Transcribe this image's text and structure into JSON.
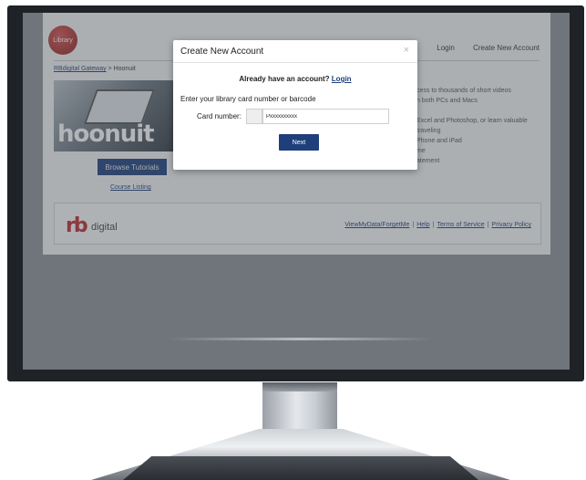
{
  "logo": {
    "text": "Library"
  },
  "top_nav": {
    "login": "Login",
    "create_account": "Create New Account"
  },
  "breadcrumb": {
    "gateway": "RBdigital Gateway",
    "separator": " > ",
    "current": "Hoonuit"
  },
  "hero": {
    "brand": "hoonuit"
  },
  "browse_button": "Browse Tutorials",
  "course_listing": "Course Listing",
  "features": [
    "cess to thousands of short videos",
    "n both PCs and Macs",
    "",
    "Excel and Photoshop, or learn valuable",
    "traveling",
    "Phone and iPad",
    "me",
    "atement"
  ],
  "footer": {
    "rb": "rb",
    "digital": "digital",
    "links": [
      "ViewMyData/ForgetMe",
      "Help",
      "Terms of Service",
      "Privacy Policy"
    ],
    "sep": "|"
  },
  "modal": {
    "title": "Create New Account",
    "close": "×",
    "already_text": "Already have an account?",
    "login_link": "Login",
    "instructions": "Enter your library card number or barcode",
    "card_label": "Card number:",
    "card_value": "Pxxxxxxxxxx",
    "next": "Next"
  }
}
